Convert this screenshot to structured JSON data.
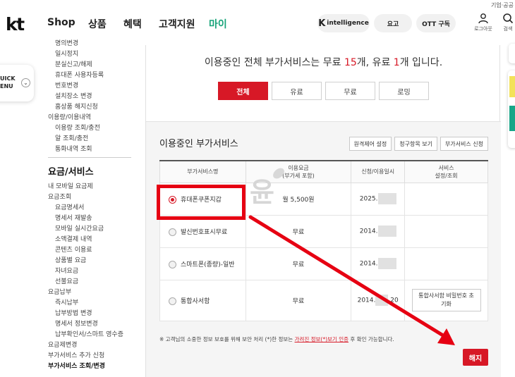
{
  "utility_text": "기업·공공",
  "brand": {
    "logo": "kt"
  },
  "gnb": [
    "Shop",
    "상품",
    "혜택",
    "고객지원",
    "마이"
  ],
  "gnb_active_color": "#18a47a",
  "pills": {
    "ai": "intelligence",
    "plan": "요고",
    "ott": "OTT 구독"
  },
  "header_icons": {
    "login_label": "로그아웃",
    "search_label": "검색"
  },
  "quick_menu": {
    "line1": "UICK",
    "line2": "ENU",
    "toggle": "⌄"
  },
  "sidebar": {
    "items": [
      {
        "label": "명의변경",
        "level": "sub"
      },
      {
        "label": "일시정지",
        "level": "sub"
      },
      {
        "label": "분실신고/해제",
        "level": "sub"
      },
      {
        "label": "휴대폰 사용자등록",
        "level": "sub"
      },
      {
        "label": "번호변경",
        "level": "sub"
      },
      {
        "label": "설치장소 변경",
        "level": "sub"
      },
      {
        "label": "홈상품 해지신청",
        "level": "sub"
      },
      {
        "label": "이용량/이용내역",
        "level": "top"
      },
      {
        "label": "이용량 조회/충전",
        "level": "sub"
      },
      {
        "label": "알 조회/충전",
        "level": "sub"
      },
      {
        "label": "통화내역 조회",
        "level": "sub"
      }
    ],
    "section_title": "요금/서비스",
    "items2": [
      {
        "label": "내 모바일 요금제",
        "level": "top"
      },
      {
        "label": "요금조회",
        "level": "top"
      },
      {
        "label": "요금명세서",
        "level": "sub"
      },
      {
        "label": "명세서 재발송",
        "level": "sub"
      },
      {
        "label": "모바일 실시간요금",
        "level": "sub"
      },
      {
        "label": "소액결제 내역",
        "level": "sub"
      },
      {
        "label": "콘텐츠 이용료",
        "level": "sub"
      },
      {
        "label": "상품별 요금",
        "level": "sub"
      },
      {
        "label": "자녀요금",
        "level": "sub"
      },
      {
        "label": "선불요금",
        "level": "sub"
      },
      {
        "label": "요금납부",
        "level": "top"
      },
      {
        "label": "즉시납부",
        "level": "sub"
      },
      {
        "label": "납부방법 변경",
        "level": "sub"
      },
      {
        "label": "명세서 정보변경",
        "level": "sub"
      },
      {
        "label": "납부확인서/스마트 영수증",
        "level": "sub"
      },
      {
        "label": "요금제변경",
        "level": "top"
      },
      {
        "label": "부가서비스 추가 신청",
        "level": "top"
      },
      {
        "label": "부가서비스 조회/변경",
        "level": "top"
      }
    ]
  },
  "summary": {
    "pre": "이용중인 전체 부가서비스는 무료 ",
    "free_count": "15",
    "mid": "개, 유료 ",
    "paid_count": "1",
    "post": "개 입니다."
  },
  "tabs": [
    {
      "label": "전체",
      "active": true
    },
    {
      "label": "유료",
      "active": false
    },
    {
      "label": "무료",
      "active": false
    },
    {
      "label": "로밍",
      "active": false
    }
  ],
  "box": {
    "title": "이용중인 부가서비스",
    "buttons": [
      "원격제어 설정",
      "청구항목 보기",
      "부가서비스 신청"
    ]
  },
  "table": {
    "headers": {
      "name": "부가서비스명",
      "fee_line1": "이용요금",
      "fee_line2": "(부가세 포함)",
      "date": "신청/이용일시",
      "svc_line1": "서비스",
      "svc_line2": "설정/조회"
    },
    "rows": [
      {
        "name": "휴대폰쿠폰지갑",
        "fee": "월 5,500원",
        "date": "2025.",
        "selected": true,
        "action": ""
      },
      {
        "name": "발신번호표시무료",
        "fee": "무료",
        "date": "2014.",
        "selected": false,
        "action": ""
      },
      {
        "name": "스마트폰(종량)-일반",
        "fee": "무료",
        "date": "2014.",
        "selected": false,
        "action": ""
      },
      {
        "name": "통합사서함",
        "fee": "무료",
        "date": "2014.",
        "date_tail": ".20",
        "selected": false,
        "action": "통합사서함 비밀번호 초기화"
      }
    ]
  },
  "note": {
    "pre": "※ 고객님의 소중한 정보 보호를 위해 보안 처리 (*)한 정보는 ",
    "link": "가려진 정보(*)보기 인증",
    "post": " 후 확인 가능합니다."
  },
  "cancel_label": "해지",
  "watermark_char": "윤",
  "colors": {
    "accent": "#d71826",
    "annotation": "#e60012"
  }
}
